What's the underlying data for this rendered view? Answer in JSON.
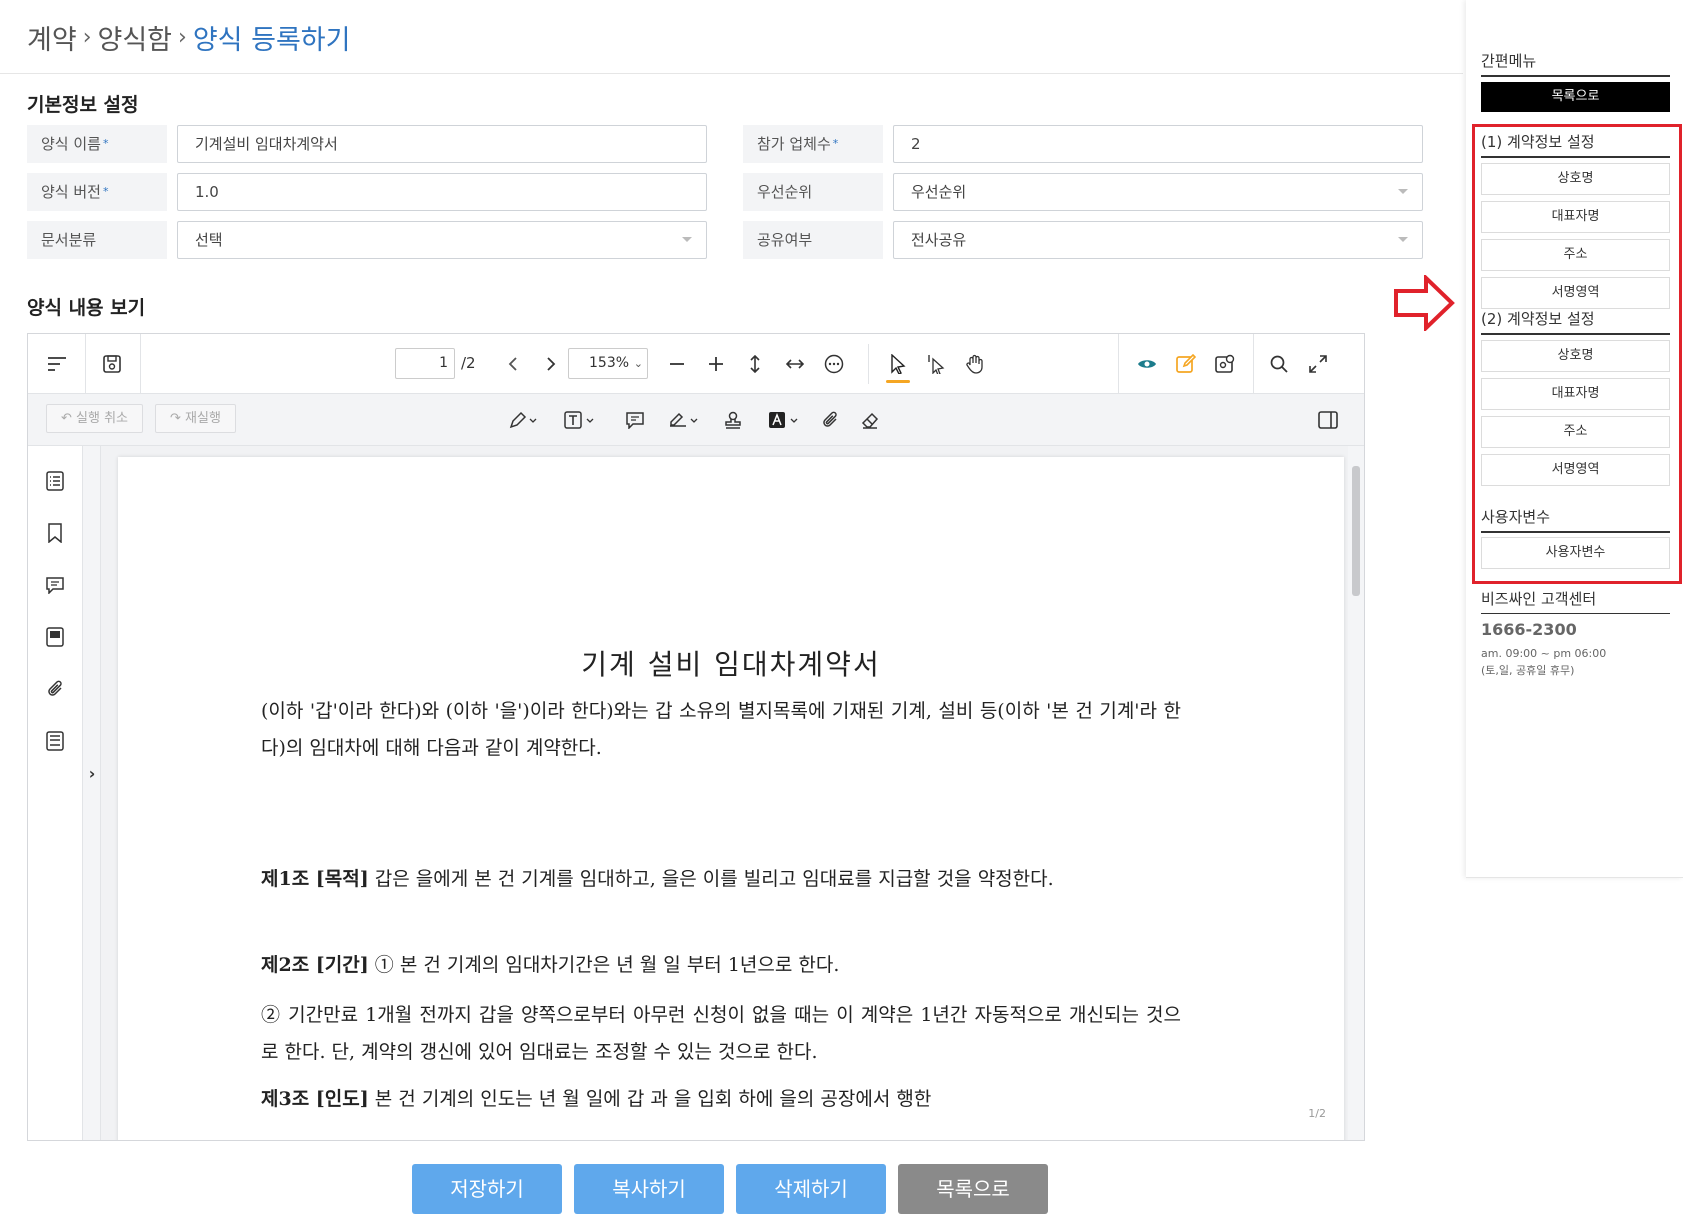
{
  "breadcrumb": {
    "item1": "계약",
    "item2": "양식함",
    "current": "양식 등록하기",
    "sep": "›"
  },
  "basic_info": {
    "title": "기본정보 설정",
    "form_name_label": "양식 이름",
    "form_name_value": "기계설비 임대차계약서",
    "participants_label": "참가 업체수",
    "participants_value": "2",
    "version_label": "양식 버전",
    "version_value": "1.0",
    "priority_label": "우선순위",
    "priority_value": "우선순위",
    "doc_category_label": "문서분류",
    "doc_category_value": "선택",
    "sharing_label": "공유여부",
    "sharing_value": "전사공유",
    "required_mark": "*"
  },
  "viewer": {
    "title": "양식 내용 보기",
    "page_current": "1",
    "page_total": "/2",
    "zoom": "153%",
    "undo_label": "실행 취소",
    "redo_label": "재실행",
    "page_indicator": "1/2",
    "document": {
      "title": "기계 설비 임대차계약서",
      "intro": "(이하 '갑'이라 한다)와                          (이하 '을')이라 한다)와는 갑 소유의 별지목록에 기재된 기계, 설비 등(이하 '본 건 기계'라 한다)의 임대차에 대해 다음과 같이 계약한다.",
      "art1_head": "제1조 [목적]",
      "art1_body": " 갑은 을에게 본 건 기계를 임대하고, 을은 이를 빌리고 임대료를 지급할 것을 약정한다.",
      "art2_head": "제2조 [기간]",
      "art2_body": " ① 본 건 기계의 임대차기간은       년     월       일 부터 1년으로 한다.",
      "art2_p2": "② 기간만료 1개월 전까지 갑을 양쪽으로부터 아무런 신청이 없을 때는 이 계약은 1년간 자동적으로 개신되는 것으로 한다. 단, 계약의 갱신에 있어 임대료는 조정할 수 있는 것으로 한다.",
      "art3_head": "제3조 [인도]",
      "art3_body": " 본 건 기계의 인도는       년     월     일에 갑 과 을 입회 하에 을의 공장에서 행한"
    }
  },
  "buttons": {
    "save": "저장하기",
    "copy": "복사하기",
    "delete": "삭제하기",
    "list": "목록으로"
  },
  "sidebar": {
    "quick_menu": "간편메뉴",
    "to_list": "목록으로",
    "section1": "(1) 계약정보 설정",
    "section1_items": [
      "상호명",
      "대표자명",
      "주소",
      "서명영역"
    ],
    "section2": "(2) 계약정보 설정",
    "section2_items": [
      "상호명",
      "대표자명",
      "주소",
      "서명영역"
    ],
    "user_vars_head": "사용자변수",
    "user_vars_item": "사용자변수",
    "cs_head": "비즈싸인 고객센터",
    "cs_phone": "1666-2300",
    "cs_hours1": "am. 09:00 ~ pm 06:00",
    "cs_hours2": "(토,일, 공휴일 휴무)"
  },
  "colors": {
    "accent": "#2f74c0",
    "button_blue": "#5fa8ec",
    "button_gray": "#8a8a8a",
    "highlight_red": "#e0222b",
    "edit_orange": "#f5a623",
    "view_teal": "#1c7c8c"
  }
}
